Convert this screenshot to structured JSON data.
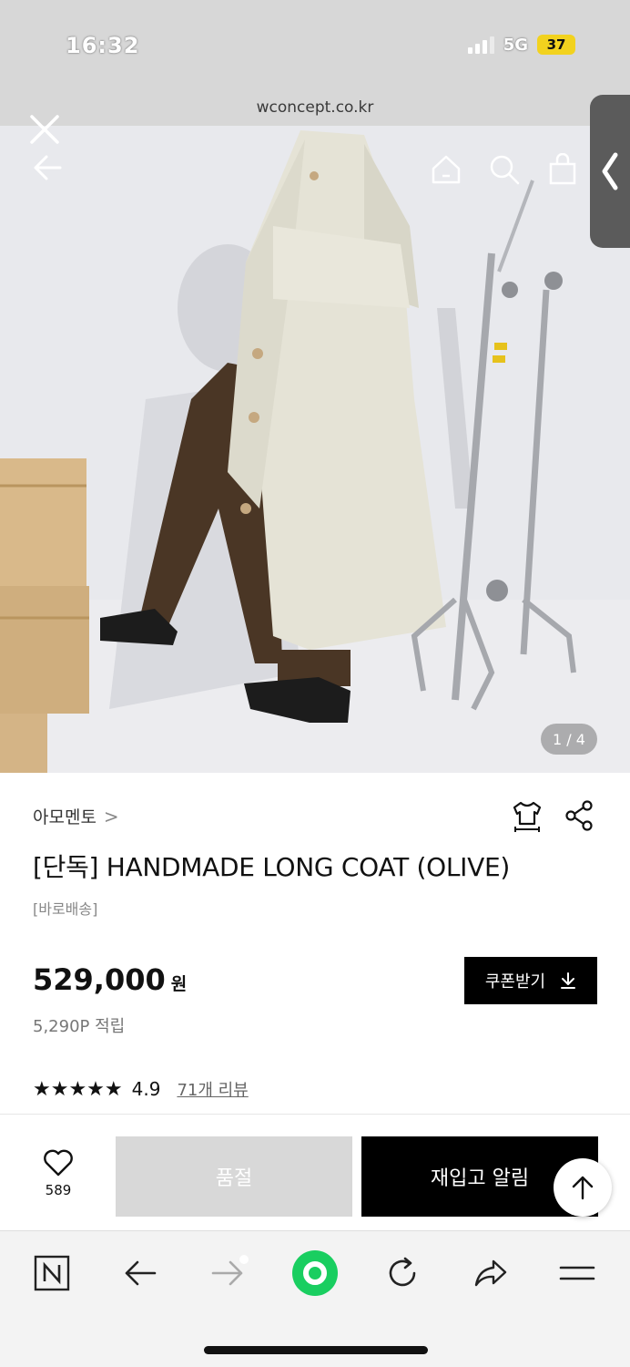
{
  "status_bar": {
    "time": "16:32",
    "network": "5G",
    "battery": "37"
  },
  "url_bar": {
    "url": "wconcept.co.kr"
  },
  "hero": {
    "icons": [
      "close-icon",
      "back-arrow-icon",
      "home-icon",
      "search-icon",
      "cart-icon"
    ],
    "counter": "1 / 4"
  },
  "product": {
    "brand": "아모멘토",
    "brand_chevron": ">",
    "title": "[단독] HANDMADE LONG COAT (OLIVE)",
    "delivery": "[바로배송]",
    "price": "529,000",
    "price_unit": "원",
    "points": "5,290P 적립",
    "coupon_label": "쿠폰받기",
    "stars": "★★★★★",
    "rating": "4.9",
    "reviews": "71개 리뷰"
  },
  "action_bar": {
    "wish_count": "589",
    "soldout_label": "품절",
    "restock_label": "재입고 알림"
  },
  "colors": {
    "accent": "#000000",
    "soldout": "#d8d8d8",
    "naver_green": "#19ce60",
    "battery": "#f2d21e"
  }
}
